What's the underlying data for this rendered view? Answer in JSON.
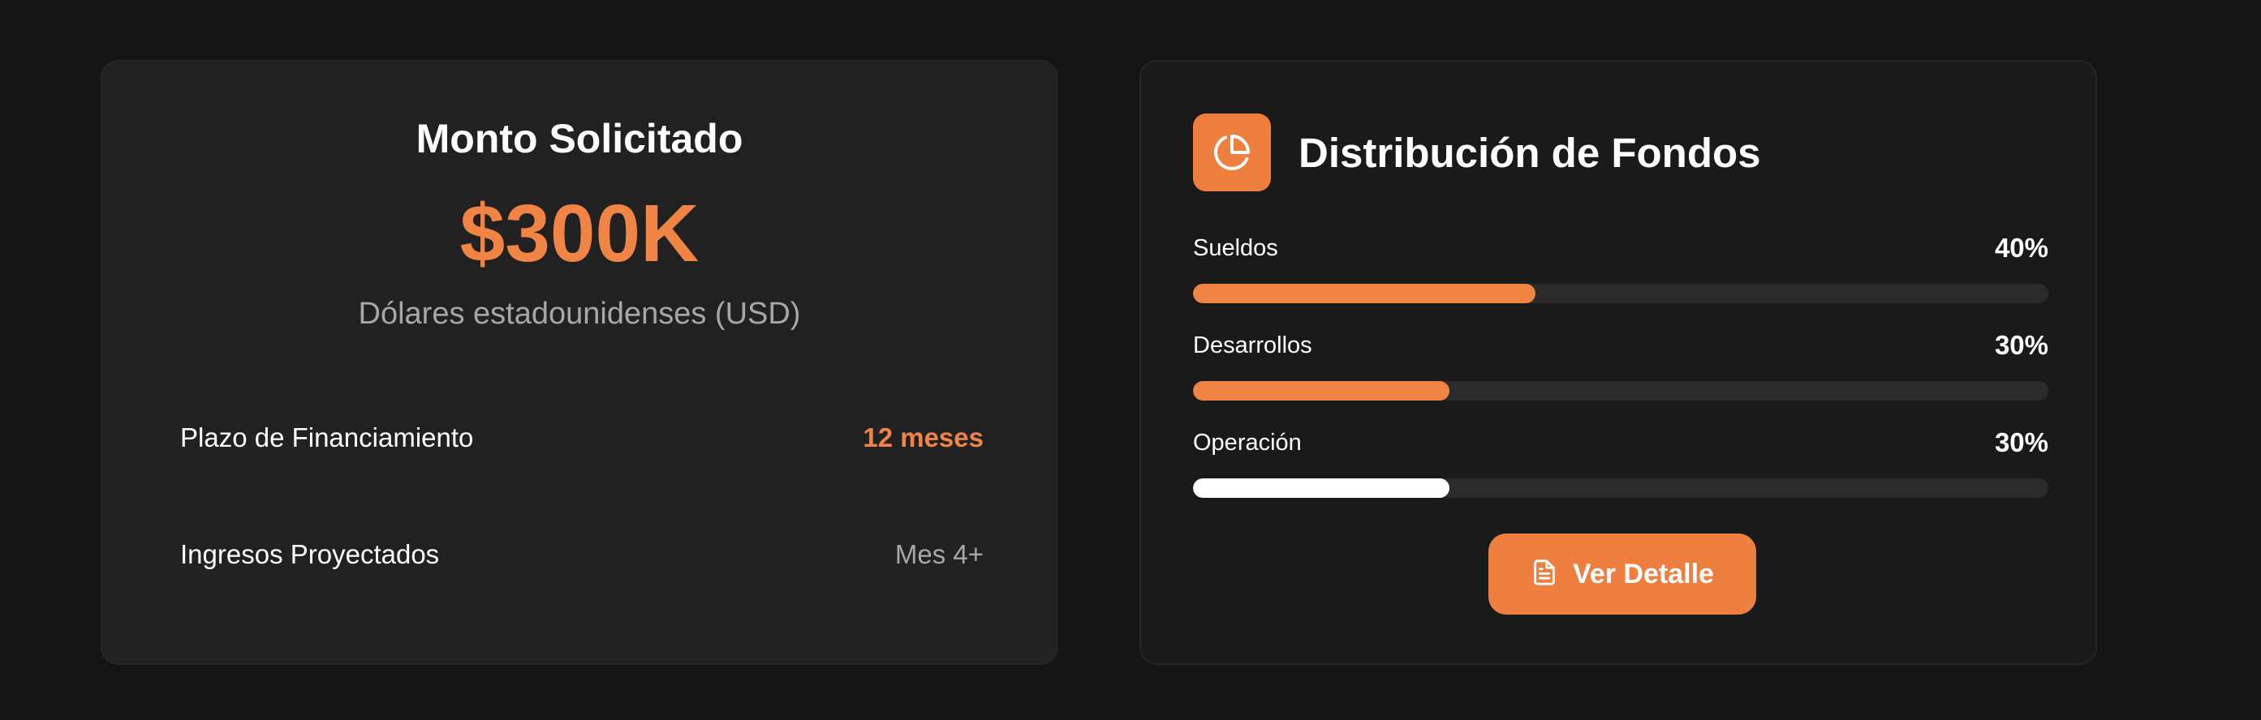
{
  "request": {
    "title": "Monto Solicitado",
    "amount": "$300K",
    "currency": "Dólares estadounidenses (USD)",
    "rows": [
      {
        "label": "Plazo de Financiamiento",
        "value": "12 meses"
      },
      {
        "label": "Ingresos Proyectados",
        "value": "Mes 4+"
      }
    ]
  },
  "distribution": {
    "title": "Distribución de Fondos",
    "icon": "pie-chart-icon",
    "items": [
      {
        "label": "Sueldos",
        "percent_text": "40%",
        "percent": 40,
        "color": "#ef8445"
      },
      {
        "label": "Desarrollos",
        "percent_text": "30%",
        "percent": 30,
        "color": "#ef8445"
      },
      {
        "label": "Operación",
        "percent_text": "30%",
        "percent": 30,
        "color": "#ffffff"
      }
    ],
    "button": {
      "label": "Ver Detalle",
      "icon": "document-icon"
    }
  },
  "colors": {
    "accent": "#ef8445",
    "background": "#151515",
    "card_left": "#212121",
    "card_right": "#1a1a1a",
    "muted_text": "#a7a7a7"
  }
}
